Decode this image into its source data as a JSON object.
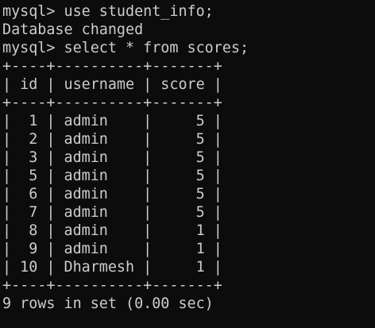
{
  "terminal": {
    "lines": [
      "mysql> use student_info;",
      "Database changed",
      "mysql> select * from scores;",
      "+----+----------+-------+",
      "| id | username | score |",
      "+----+----------+-------+",
      "|  1 | admin    |     5 |",
      "|  2 | admin    |     5 |",
      "|  3 | admin    |     5 |",
      "|  5 | admin    |     5 |",
      "|  6 | admin    |     5 |",
      "|  7 | admin    |     5 |",
      "|  8 | admin    |     1 |",
      "|  9 | admin    |     1 |",
      "| 10 | Dharmesh |     1 |",
      "+----+----------+-------+",
      "9 rows in set (0.00 sec)"
    ],
    "colors": {
      "background": "#0c0c0c",
      "text": "#cccccc"
    }
  }
}
